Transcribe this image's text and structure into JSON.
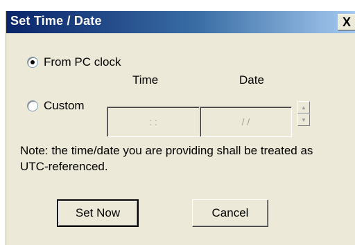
{
  "window": {
    "title": "Set Time / Date",
    "close_symbol": "X"
  },
  "options": {
    "from_pc_clock_label": "From PC clock",
    "custom_label": "Custom",
    "selected": "From PC clock"
  },
  "custom": {
    "time_header": "Time",
    "date_header": "Date",
    "time_value": ":   :",
    "date_value": "/   /"
  },
  "note": "Note: the time/date you are providing shall be treated as UTC-referenced.",
  "buttons": {
    "set_now": "Set Now",
    "cancel": "Cancel"
  }
}
